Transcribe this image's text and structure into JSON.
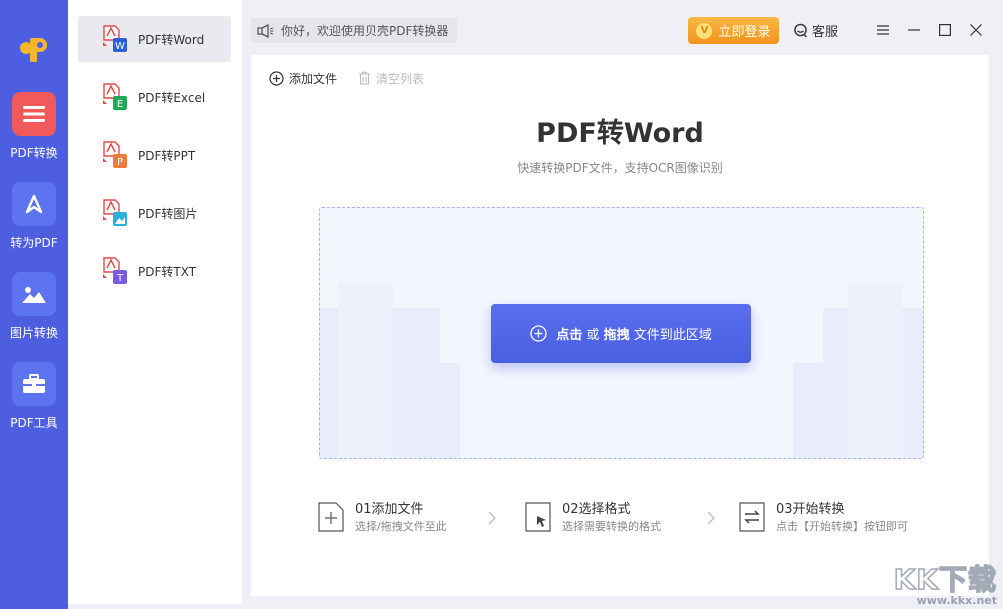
{
  "nav": {
    "items": [
      {
        "label": "PDF转换",
        "icon": "menu-icon",
        "active": true
      },
      {
        "label": "转为PDF",
        "icon": "triangle-icon"
      },
      {
        "label": "图片转换",
        "icon": "image-icon"
      },
      {
        "label": "PDF工具",
        "icon": "toolbox-icon"
      }
    ]
  },
  "submenu": {
    "items": [
      {
        "label": "PDF转Word",
        "badge": "W",
        "color": "#2b5fd9",
        "active": true
      },
      {
        "label": "PDF转Excel",
        "badge": "E",
        "color": "#1faa5a"
      },
      {
        "label": "PDF转PPT",
        "badge": "P",
        "color": "#f07a3a"
      },
      {
        "label": "PDF转图片",
        "badge": "",
        "color": "#27b3d8"
      },
      {
        "label": "PDF转TXT",
        "badge": "T",
        "color": "#7a5ce0"
      }
    ]
  },
  "topbar": {
    "notice": "你好，欢迎使用贝壳PDF转换器",
    "login_badge": "V",
    "login": "立即登录",
    "service": "客服"
  },
  "toolbar": {
    "add": "添加文件",
    "clear": "清空列表"
  },
  "main": {
    "title": "PDF转Word",
    "subtitle": "快速转换PDF文件，支持OCR图像识别",
    "drop": {
      "part1": "点击",
      "part2": " 或 ",
      "part3": "拖拽",
      "part4": " 文件到此区域"
    }
  },
  "steps": [
    {
      "title": "01添加文件",
      "desc": "选择/拖拽文件至此"
    },
    {
      "title": "02选择格式",
      "desc": "选择需要转换的格式"
    },
    {
      "title": "03开始转换",
      "desc": "点击【开始转换】按钮即可"
    }
  ],
  "watermark": {
    "big": "KK下载",
    "small": "www.kkx.net"
  },
  "colors": {
    "primary": "#4d5fe0",
    "accent": "#f2941c",
    "active_nav": "#f05a5a"
  }
}
